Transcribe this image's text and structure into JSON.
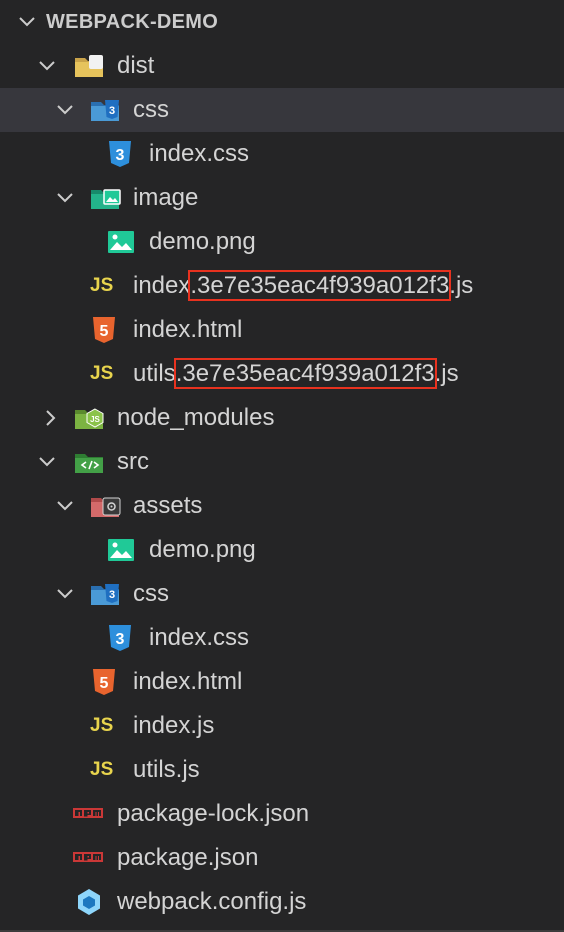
{
  "explorer": {
    "project_name": "WEBPACK-DEMO",
    "rows": {
      "dist": "dist",
      "dist_css": "css",
      "dist_css_index": "index.css",
      "dist_image": "image",
      "dist_image_demo": "demo.png",
      "dist_index_js_prefix": "index",
      "dist_index_js_hash": ".3e7e35eac4f939a012f3",
      "dist_index_js_ext": ".js",
      "dist_index_html": "index.html",
      "dist_utils_js_prefix": "utils",
      "dist_utils_js_hash": ".3e7e35eac4f939a012f3",
      "dist_utils_js_ext": ".js",
      "node_modules": "node_modules",
      "src": "src",
      "src_assets": "assets",
      "src_assets_demo": "demo.png",
      "src_css": "css",
      "src_css_index": "index.css",
      "src_index_html": "index.html",
      "src_index_js": "index.js",
      "src_utils_js": "utils.js",
      "package_lock": "package-lock.json",
      "package_json": "package.json",
      "webpack_config": "webpack.config.js"
    },
    "icons": {
      "js_glyph": "JS",
      "npm_glyph": "npm"
    },
    "colors": {
      "background": "#252526",
      "selected_row": "#37373d",
      "text": "#d4d4d4",
      "highlight_box": "#e8321f",
      "js_yellow": "#e8d44d",
      "css_blue": "#2d8fdc",
      "html_orange": "#e8642e",
      "image_green": "#20c997",
      "npm_red": "#cb3837",
      "webpack_blue": "#8ed6fb"
    }
  }
}
